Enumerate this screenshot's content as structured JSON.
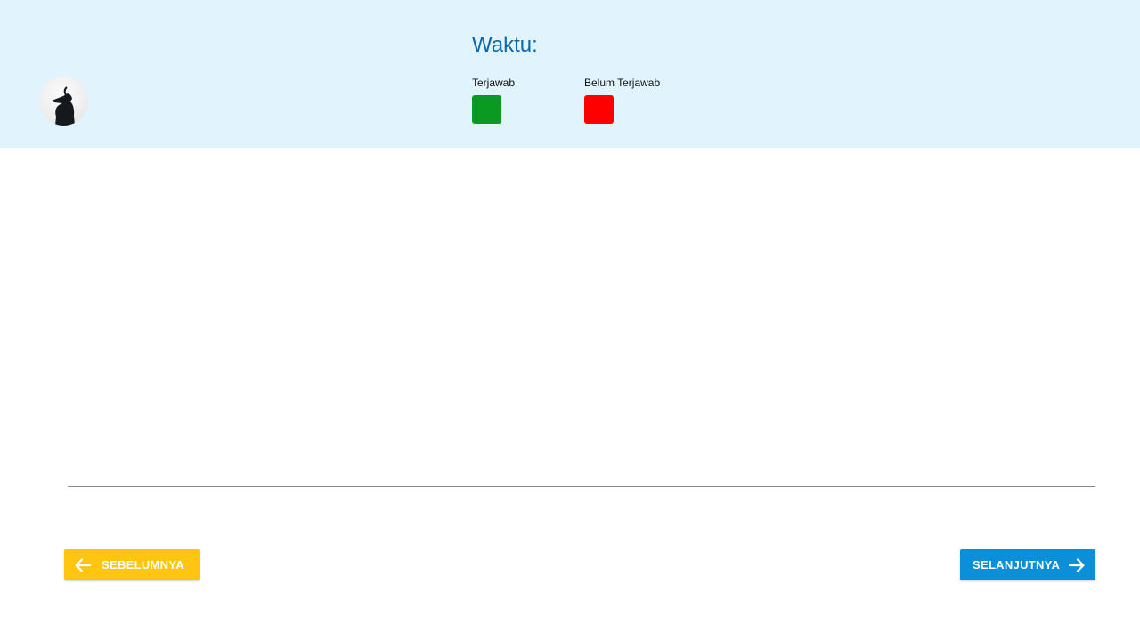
{
  "header": {
    "timer_label": "Waktu:",
    "legend": [
      {
        "label": "Terjawab",
        "color": "#0a9a22"
      },
      {
        "label": "Belum Terjawab",
        "color": "#ff0000"
      }
    ]
  },
  "avatar": {
    "icon": "profile-silhouette-icon"
  },
  "navigation": {
    "prev_label": "SEBELUMNYA",
    "prev_icon": "arrow-left-icon",
    "prev_color": "#ffc510",
    "next_label": "SELANJUTNYA",
    "next_icon": "arrow-right-icon",
    "next_color": "#0b8fd9"
  }
}
